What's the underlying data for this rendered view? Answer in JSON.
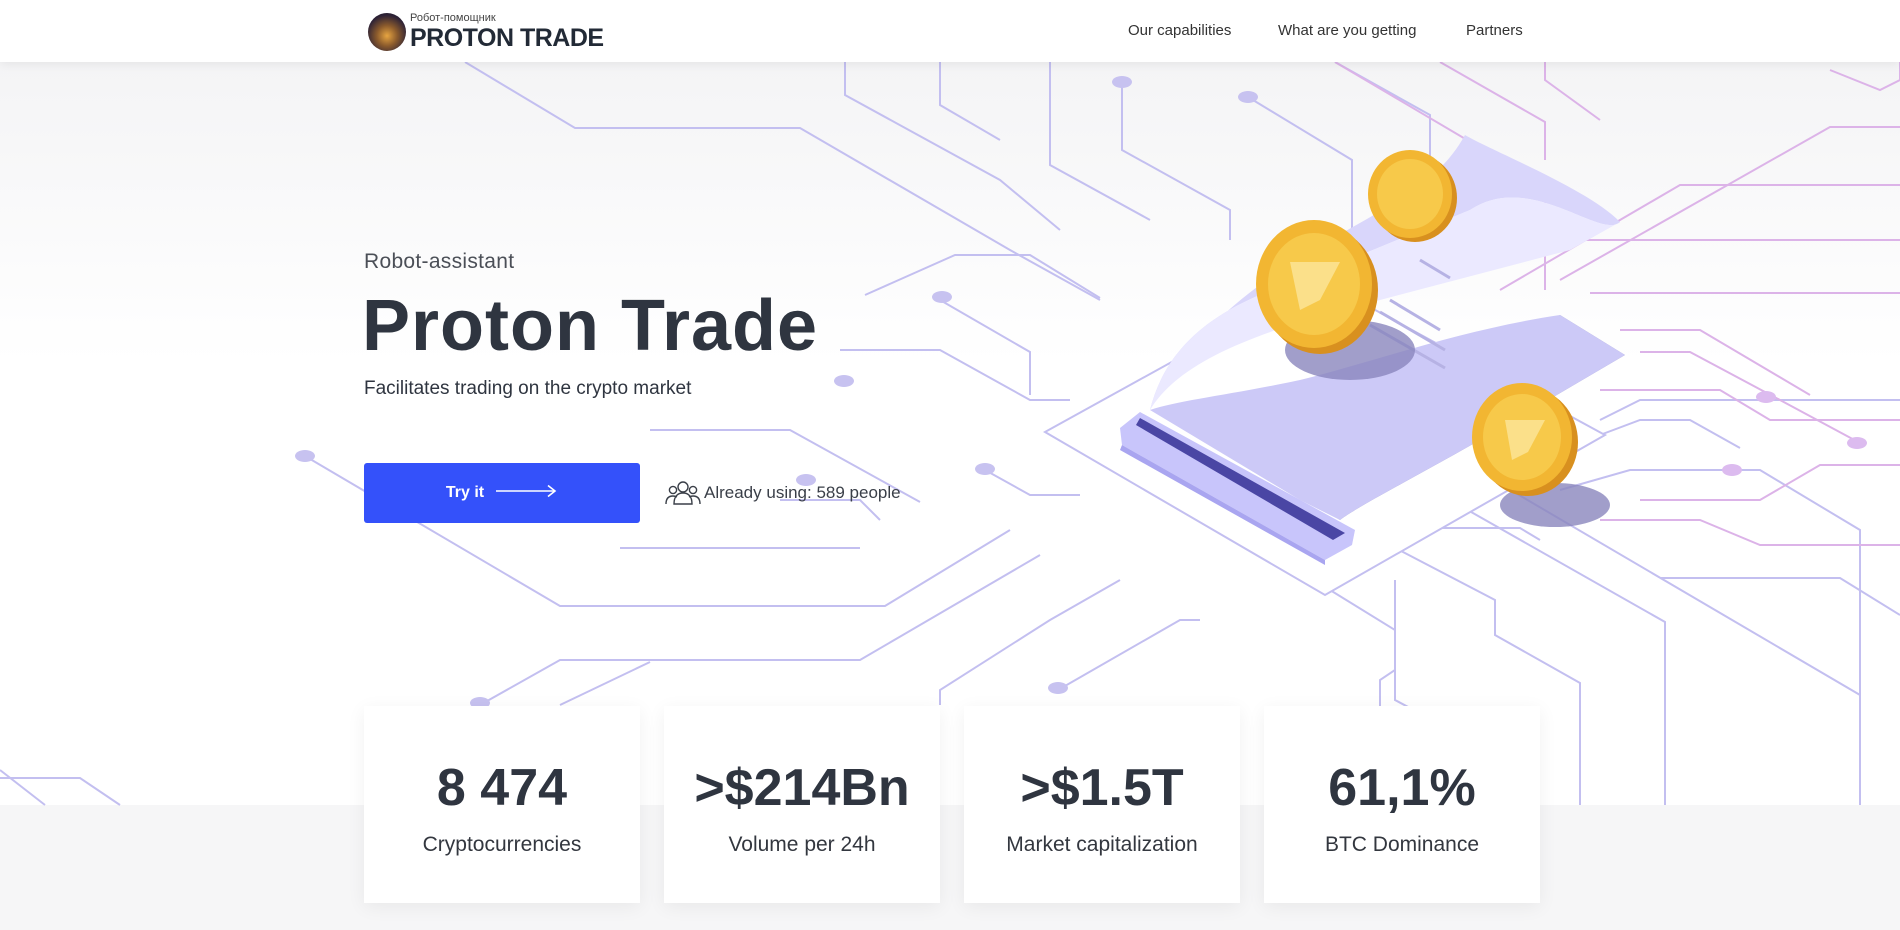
{
  "header": {
    "logo_sub": "Робот-помощник",
    "logo_main": "PROTON TRADE",
    "nav": [
      "Our capabilities",
      "What are you getting",
      "Partners"
    ]
  },
  "hero": {
    "kicker": "Robot-assistant",
    "title": "Proton Trade",
    "description": "Facilitates trading on the crypto market",
    "cta_label": "Try it",
    "cta_icon": "arrow-right-icon",
    "users_icon": "users-icon",
    "users_text": "Already using: 589 people"
  },
  "stats": [
    {
      "value": "8 474",
      "label": "Cryptocurrencies"
    },
    {
      "value": ">$214Bn",
      "label": "Volume per 24h"
    },
    {
      "value": ">$1.5T",
      "label": "Market capitalization"
    },
    {
      "value": "61,1%",
      "label": "BTC Dominance"
    }
  ],
  "colors": {
    "accent": "#3451fa",
    "text_dark": "#2f3540",
    "circuit_line": "#b7b3ec",
    "circuit_pink": "#dcb3e8",
    "coin_gold": "#f2b632"
  }
}
